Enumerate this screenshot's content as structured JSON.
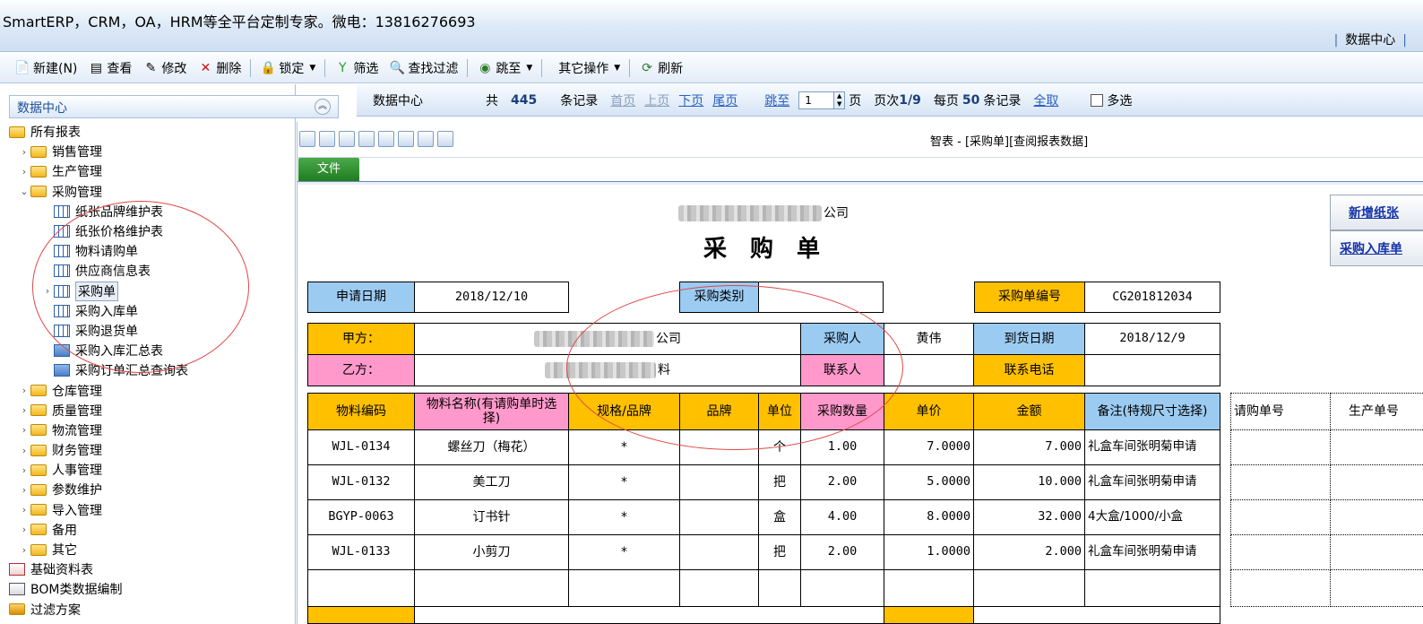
{
  "titlebar": {
    "title": "SmartERP，CRM，OA，HRM等全平台定制专家。微电：13816276693",
    "right_link": "数据中心"
  },
  "toolbar": {
    "new": "新建(N)",
    "view": "查看",
    "edit": "修改",
    "delete": "删除",
    "lock": "锁定",
    "filter": "筛选",
    "find_filter": "查找过滤",
    "goto": "跳至",
    "other_ops": "其它操作",
    "refresh": "刷新"
  },
  "leftpane": {
    "header": "数据中心",
    "tree": {
      "root": "所有报表",
      "sales": "销售管理",
      "production": "生产管理",
      "purchase": "采购管理",
      "purchase_items": [
        "纸张品牌维护表",
        "纸张价格维护表",
        "物料请购单",
        "供应商信息表",
        "采购单",
        "采购入库单",
        "采购退货单",
        "采购入库汇总表",
        "采购订单汇总查询表"
      ],
      "warehouse": "仓库管理",
      "quality": "质量管理",
      "logistics": "物流管理",
      "finance": "财务管理",
      "hr": "人事管理",
      "params": "参数维护",
      "import": "导入管理",
      "backup": "备用",
      "others": "其它",
      "basic": "基础资料表",
      "bom": "BOM类数据编制",
      "filter_plan": "过滤方案"
    }
  },
  "navbar": {
    "center": "数据中心",
    "total_prefix": "共",
    "total": "445",
    "records": "条记录",
    "first": "首页",
    "prev": "上页",
    "next": "下页",
    "last": "尾页",
    "goto": "跳至",
    "page_value": "1",
    "page_unit": "页",
    "page_info": "页次",
    "page_index": "1/9",
    "per_page_prefix": "每页",
    "per_page": "50",
    "per_page_suffix": "条记录",
    "all": "全取",
    "multi": "多选"
  },
  "report": {
    "caption": "智表 - [采购单][查阅报表数据]",
    "file_tab": "文件",
    "company_suffix": "公司",
    "title": "采　购　单",
    "apply_date_label": "申请日期",
    "apply_date": "2018/12/10",
    "category_label": "采购类别",
    "category": "",
    "order_no_label": "采购单编号",
    "order_no": "CG201812034",
    "party_a_label": "甲方：",
    "party_a_suffix": "公司",
    "buyer_label": "采购人",
    "buyer": "黄伟",
    "arrival_label": "到货日期",
    "arrival": "2018/12/9",
    "party_b_label": "乙方：",
    "party_b_suffix": "料",
    "contact_label": "联系人",
    "contact": "",
    "phone_label": "联系电话",
    "phone": "",
    "columns": [
      "物料编码",
      "物料名称(有请购单时选择)",
      "规格/品牌",
      "品牌",
      "单位",
      "采购数量",
      "单价",
      "金额",
      "备注(特规尺寸选择)"
    ],
    "extra_columns": [
      "请购单号",
      "生产单号"
    ],
    "rows": [
      {
        "code": "WJL-0134",
        "name": "螺丝刀（梅花）",
        "spec": "*",
        "brand": "",
        "unit": "个",
        "qty": "1.00",
        "price": "7.0000",
        "amount": "7.000",
        "note": "礼盒车间张明菊申请"
      },
      {
        "code": "WJL-0132",
        "name": "美工刀",
        "spec": "*",
        "brand": "",
        "unit": "把",
        "qty": "2.00",
        "price": "5.0000",
        "amount": "10.000",
        "note": "礼盒车间张明菊申请"
      },
      {
        "code": "BGYP-0063",
        "name": "订书针",
        "spec": "*",
        "brand": "",
        "unit": "盒",
        "qty": "4.00",
        "price": "8.0000",
        "amount": "32.000",
        "note": "4大盒/1000/小盒"
      },
      {
        "code": "WJL-0133",
        "name": "小剪刀",
        "spec": "*",
        "brand": "",
        "unit": "把",
        "qty": "2.00",
        "price": "1.0000",
        "amount": "2.000",
        "note": "礼盒车间张明菊申请"
      }
    ],
    "side_buttons": [
      "新增纸张",
      "采购入库单"
    ]
  },
  "colors": {
    "blue_header": "#9ccbf2",
    "yellow_header": "#ffc000",
    "pink_header": "#ff99cc",
    "annotation": "#e04848"
  },
  "icons": [
    "new-icon",
    "view-icon",
    "edit-icon",
    "delete-icon",
    "lock-icon",
    "filter-icon",
    "find-filter-icon",
    "goto-icon",
    "refresh-icon"
  ]
}
